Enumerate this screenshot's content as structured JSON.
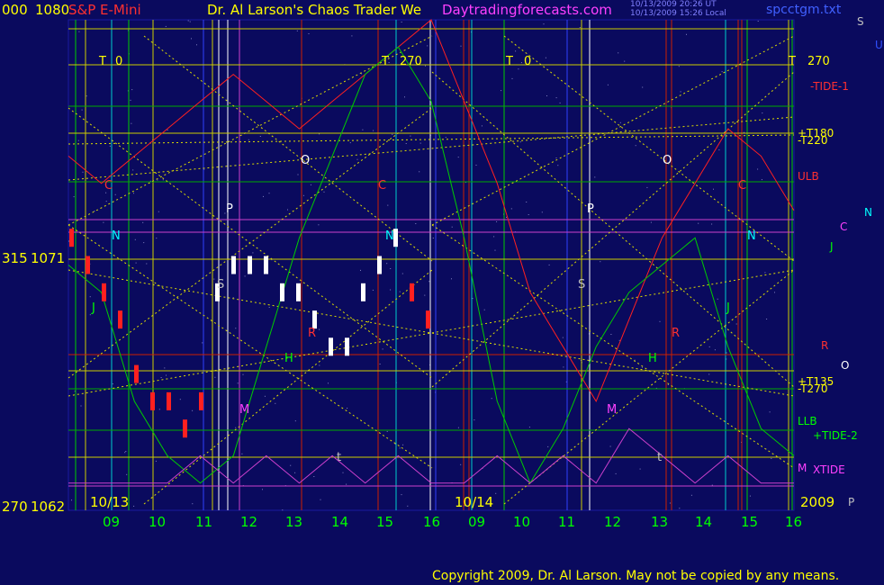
{
  "header": {
    "left_price_prefix": "000",
    "top_price": "1080",
    "instrument": "S&P E-Mini",
    "title": "Dr. Al Larson's Chaos Trader We",
    "website": "Daytradingforecasts.com",
    "timestamp_1": "10/13/2009 20:26 UT",
    "timestamp_2": "10/13/2009 15:26 Local",
    "data_file": "spcctgm.txt"
  },
  "price_axis": {
    "mid_degree": "315",
    "mid_price": "1071",
    "bottom_degree": "270",
    "bottom_price": "1062"
  },
  "dates": {
    "left_date": "10/13",
    "right_date": "10/14",
    "year": "2009"
  },
  "time_axis": [
    "09",
    "10",
    "11",
    "12",
    "13",
    "14",
    "15",
    "16",
    "09",
    "10",
    "11",
    "12",
    "13",
    "14",
    "15",
    "16"
  ],
  "tide_markers": [
    {
      "text": "T",
      "cls": "yellow"
    },
    {
      "text": "0",
      "cls": "yellow"
    },
    {
      "text": "T",
      "cls": "yellow"
    },
    {
      "text": "270",
      "cls": "yellow"
    },
    {
      "text": "T",
      "cls": "yellow"
    },
    {
      "text": "0",
      "cls": "yellow"
    },
    {
      "text": "T",
      "cls": "yellow"
    },
    {
      "text": "270",
      "cls": "yellow"
    }
  ],
  "planet_markers": [
    "C",
    "N",
    "J",
    "S",
    "P",
    "O",
    "M",
    "H",
    "R",
    "t",
    "C",
    "N",
    "S",
    "P",
    "O",
    "M",
    "H",
    "R",
    "J",
    "C",
    "N",
    "t"
  ],
  "right_legend": [
    {
      "text": "S",
      "cls": "grey"
    },
    {
      "text": "U",
      "cls": "blue"
    },
    {
      "text": "-TIDE-1",
      "cls": "red"
    },
    {
      "text": "+T180",
      "cls": "yellow"
    },
    {
      "text": "-T220",
      "cls": "yellow"
    },
    {
      "text": "ULB",
      "cls": "red"
    },
    {
      "text": "N",
      "cls": "cyan"
    },
    {
      "text": "C",
      "cls": "magenta"
    },
    {
      "text": "J",
      "cls": "green"
    },
    {
      "text": "R",
      "cls": "red"
    },
    {
      "text": "O",
      "cls": "white"
    },
    {
      "text": "+T135",
      "cls": "yellow"
    },
    {
      "text": "-T270",
      "cls": "yellow"
    },
    {
      "text": "LLB",
      "cls": "green"
    },
    {
      "text": "+TIDE-2",
      "cls": "green"
    },
    {
      "text": "M",
      "cls": "magenta"
    },
    {
      "text": "XTIDE",
      "cls": "magenta"
    },
    {
      "text": "P",
      "cls": "grey"
    }
  ],
  "footer": {
    "copyright": "Copyright 2009, Dr. Al Larson. May not be copied by any means."
  },
  "colors": {
    "background": "#0a0a5e",
    "grid_vertical_green": "#00cc00",
    "grid_vertical_yellow": "#cccc00",
    "grid_vertical_red": "#cc2000",
    "diagonal": "#dddd00"
  },
  "chart_data": {
    "type": "line",
    "title": "S&P E-Mini",
    "ylim": [
      1062,
      1080
    ],
    "series": [
      {
        "name": "ULB",
        "values": [
          1075,
          1074,
          1075,
          1076,
          1077,
          1078,
          1077,
          1076,
          1077,
          1078,
          1079,
          1080,
          1077,
          1074,
          1070,
          1068,
          1066,
          1069,
          1072,
          1074,
          1076,
          1075,
          1073
        ]
      },
      {
        "name": "LLB",
        "values": [
          1071,
          1070,
          1066,
          1064,
          1063,
          1064,
          1068,
          1072,
          1075,
          1078,
          1079,
          1077,
          1072,
          1066,
          1063,
          1065,
          1068,
          1070,
          1071,
          1072,
          1068,
          1065,
          1064
        ]
      },
      {
        "name": "XTIDE",
        "values": [
          1063,
          1063,
          1063,
          1063,
          1064,
          1063,
          1064,
          1063,
          1064,
          1063,
          1064,
          1063,
          1063,
          1064,
          1063,
          1064,
          1063,
          1065,
          1064,
          1063,
          1064,
          1063,
          1063
        ]
      }
    ],
    "price_bars": [
      1072,
      1071,
      1070,
      1069,
      1067,
      1066,
      1066,
      1065,
      1066,
      1070,
      1071,
      1071,
      1071,
      1070,
      1070,
      1069,
      1068,
      1068,
      1070,
      1071,
      1072,
      1070,
      1069
    ]
  }
}
